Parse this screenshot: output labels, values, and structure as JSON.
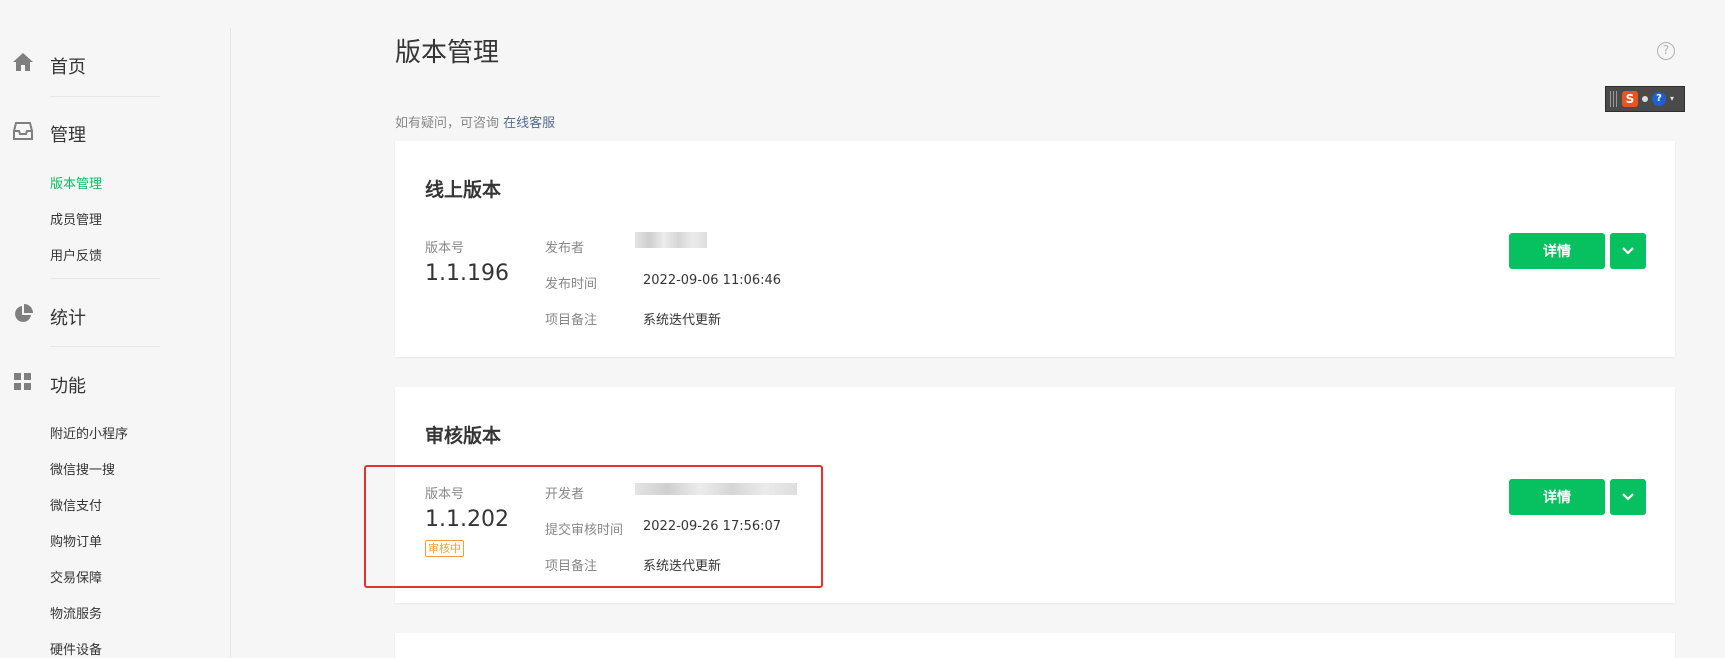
{
  "sidebar": {
    "sections": [
      {
        "label": "首页",
        "icon": "home-icon"
      },
      {
        "label": "管理",
        "icon": "inbox-icon"
      },
      {
        "label": "统计",
        "icon": "pie-chart-icon"
      },
      {
        "label": "功能",
        "icon": "grid-icon"
      }
    ],
    "management_items": [
      {
        "label": "版本管理",
        "active": true
      },
      {
        "label": "成员管理"
      },
      {
        "label": "用户反馈"
      }
    ],
    "feature_items": [
      {
        "label": "附近的小程序"
      },
      {
        "label": "微信搜一搜"
      },
      {
        "label": "微信支付"
      },
      {
        "label": "购物订单"
      },
      {
        "label": "交易保障"
      },
      {
        "label": "物流服务"
      },
      {
        "label": "硬件设备"
      }
    ]
  },
  "header": {
    "title": "版本管理",
    "help_icon": "help-circle-icon",
    "help_glyph": "?"
  },
  "ime": {
    "logo": "S",
    "help": "?"
  },
  "notice": {
    "text": "如有疑问，可咨询",
    "link": "在线客服"
  },
  "online_version": {
    "title": "线上版本",
    "version_label": "版本号",
    "version": "1.1.196",
    "fields": [
      {
        "label": "发布者",
        "value": ""
      },
      {
        "label": "发布时间",
        "value": "2022-09-06 11:06:46"
      },
      {
        "label": "项目备注",
        "value": "系统迭代更新"
      }
    ],
    "detail_button": "详情"
  },
  "review_version": {
    "title": "审核版本",
    "version_label": "版本号",
    "version": "1.1.202",
    "status": "审核中",
    "fields": [
      {
        "label": "开发者",
        "value": ""
      },
      {
        "label": "提交审核时间",
        "value": "2022-09-26 17:56:07"
      },
      {
        "label": "项目备注",
        "value": "系统迭代更新"
      }
    ],
    "detail_button": "详情"
  },
  "colors": {
    "accent": "#07c160",
    "link": "#576b95",
    "status": "#fa9d3b",
    "highlight": "#e5322d"
  }
}
